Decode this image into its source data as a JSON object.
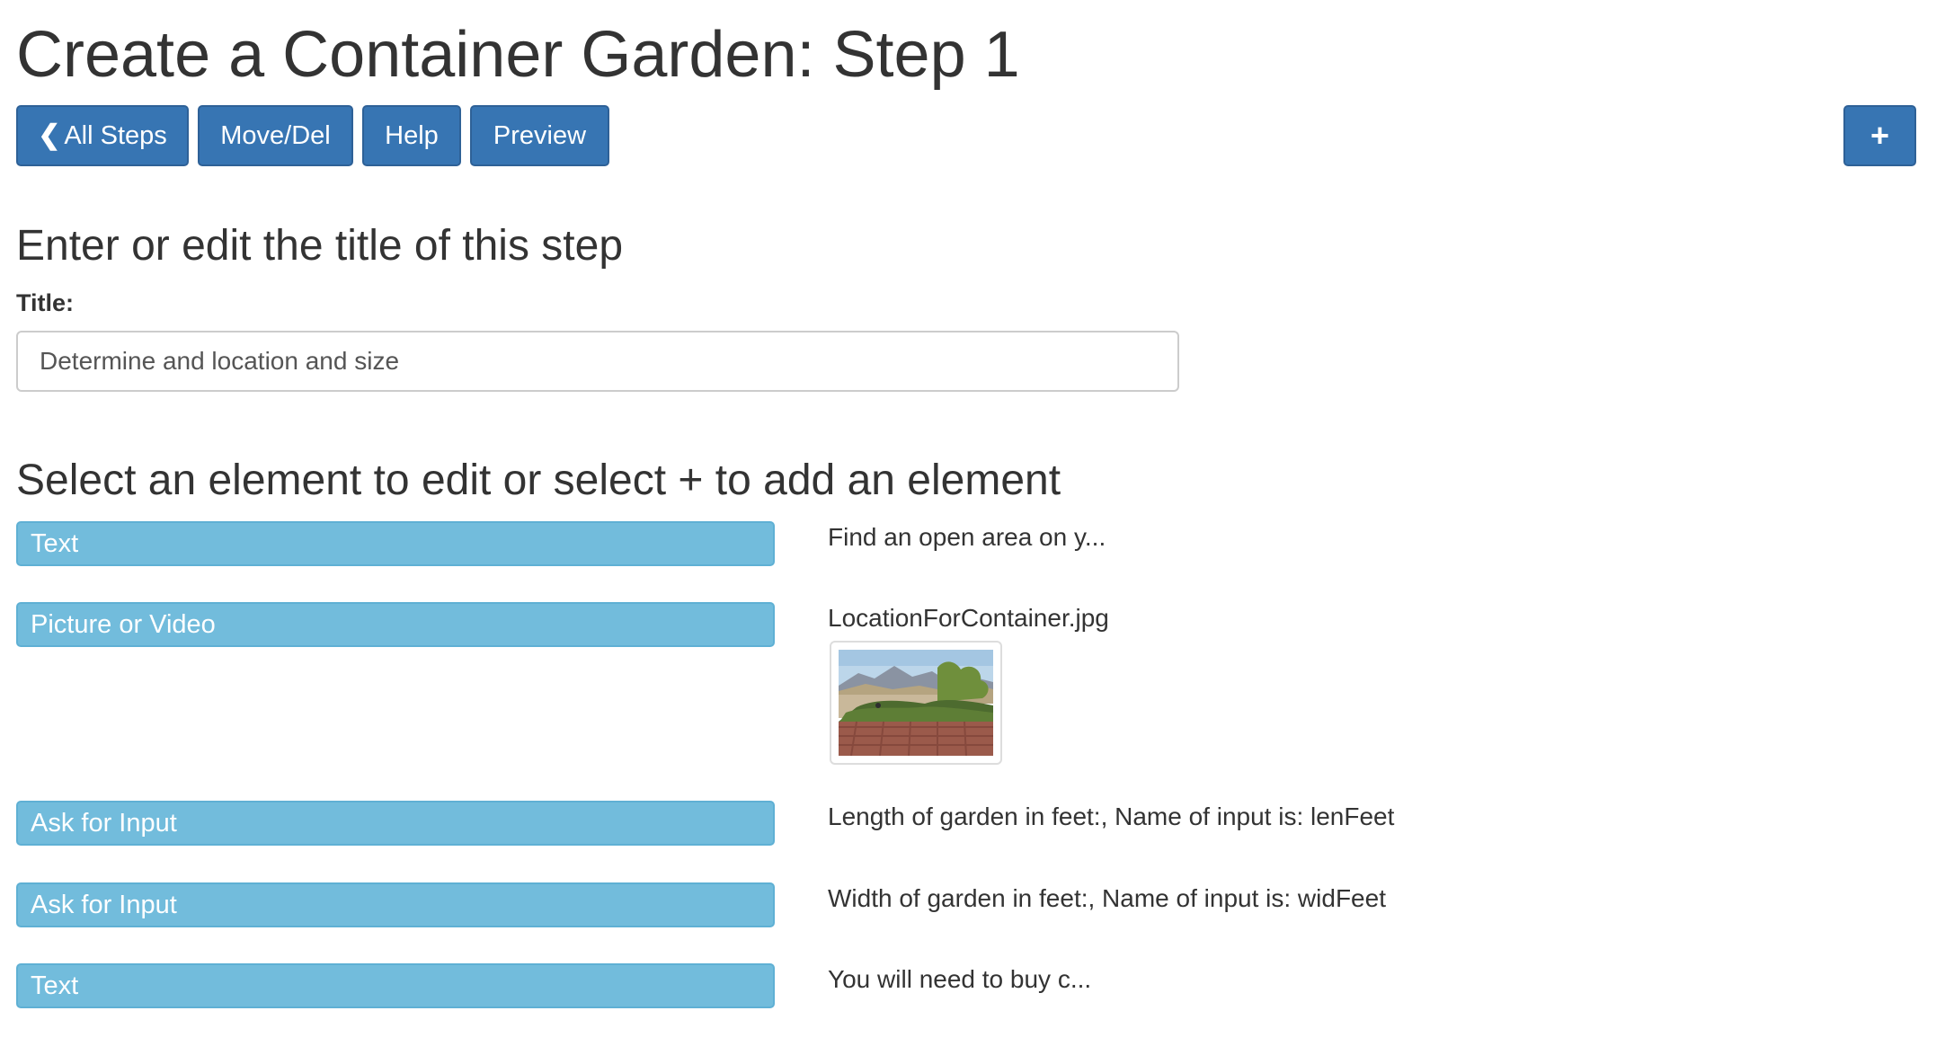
{
  "page": {
    "title": "Create a Container Garden: Step 1"
  },
  "toolbar": {
    "all_steps_label": "All Steps",
    "move_del_label": "Move/Del",
    "help_label": "Help",
    "preview_label": "Preview",
    "add_label": "+"
  },
  "title_section": {
    "heading": "Enter or edit the title of this step",
    "label": "Title:",
    "value": "Determine and location and size"
  },
  "elements_section": {
    "heading": "Select an element to edit or select + to add an element",
    "items": [
      {
        "type": "Text",
        "description": "Find an open area on y..."
      },
      {
        "type": "Picture or Video",
        "description": "LocationForContainer.jpg"
      },
      {
        "type": "Ask for Input",
        "description": "Length of garden in feet:, Name of input is: lenFeet"
      },
      {
        "type": "Ask for Input",
        "description": "Width of garden in feet:, Name of input is: widFeet"
      },
      {
        "type": "Text",
        "description": "You will need to buy c..."
      }
    ]
  },
  "colors": {
    "primary_button": "#3775b3",
    "element_button": "#72bcdc",
    "text": "#333333"
  },
  "icons": {
    "back": "chevron-left-icon",
    "add": "plus-icon"
  }
}
